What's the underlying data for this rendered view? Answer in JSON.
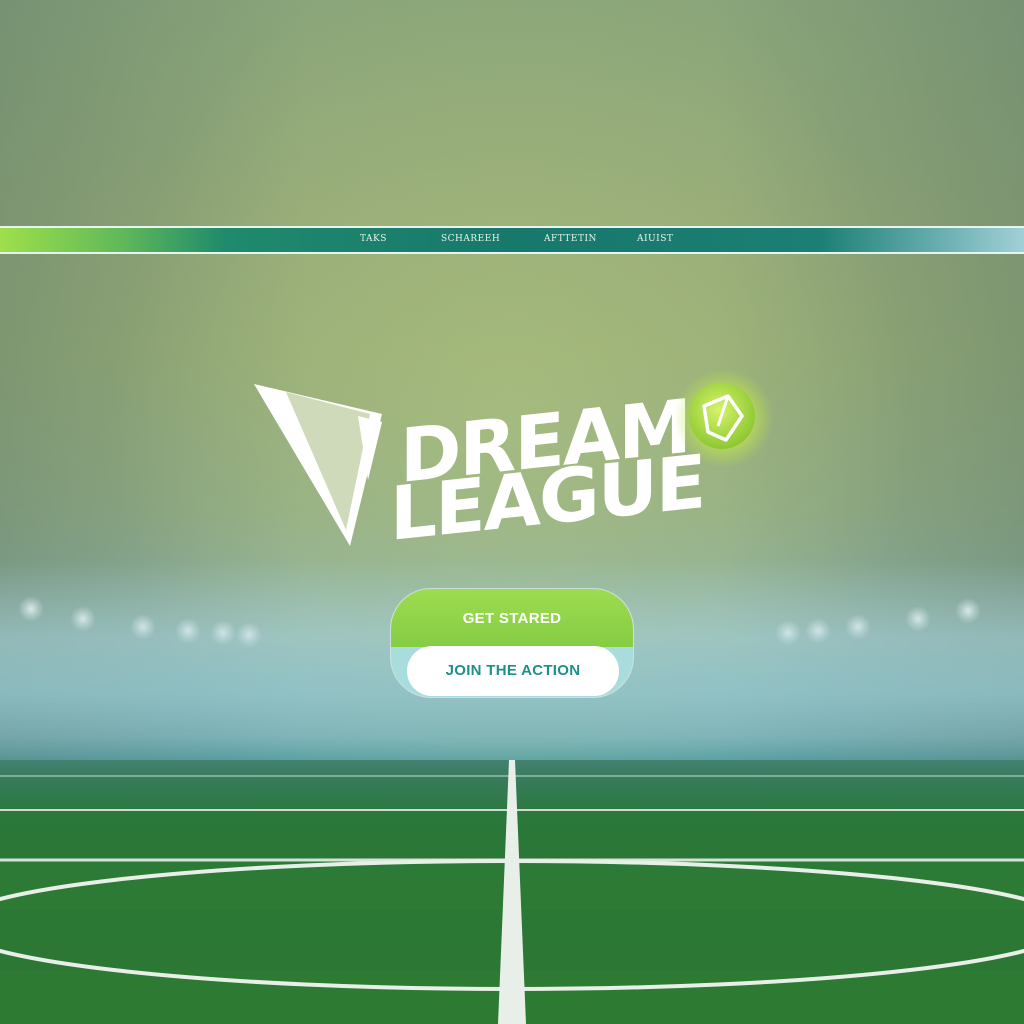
{
  "nav": {
    "items": [
      {
        "label": "TAKS"
      },
      {
        "label": "SCHAREEH"
      },
      {
        "label": "AFTTETIN"
      },
      {
        "label": "AIUIST"
      }
    ]
  },
  "logo": {
    "line1": "DREAM",
    "line2": "LEAGUE",
    "icon": "soccer-ball-icon"
  },
  "cta": {
    "primary_label": "GET STARED",
    "secondary_label": "JOIN THE ACTION"
  },
  "colors": {
    "accent_green": "#86cc45",
    "teal": "#17786c",
    "secondary_text": "#1f8f8c",
    "pitch": "#2c7a34"
  }
}
